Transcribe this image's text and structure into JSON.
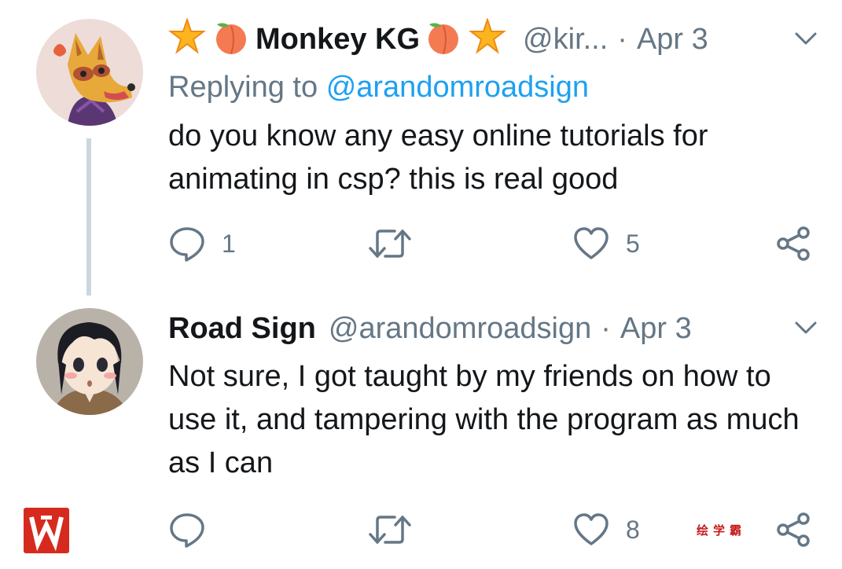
{
  "tweets": [
    {
      "name_prefix_emoji": "🌟🍑",
      "name": "Monkey KG",
      "name_suffix_emoji": "🍑🌟",
      "handle": "@kir...",
      "separator": "·",
      "date": "Apr 3",
      "replying_label": "Replying to",
      "replying_handle": "@arandomroadsign",
      "body": "do you know any easy online tutorials for animating in csp? this is real good",
      "reply_count": "1",
      "retweet_count": "",
      "like_count": "5"
    },
    {
      "name": "Road Sign",
      "handle": "@arandomroadsign",
      "separator": "·",
      "date": "Apr 3",
      "body": "Not sure, I got taught by my friends on how to use it, and tampering with the program as much as I can",
      "reply_count": "",
      "retweet_count": "",
      "like_count": "8"
    }
  ],
  "watermark": {
    "right_text": "绘学霸"
  },
  "colors": {
    "text_primary": "#14171a",
    "text_secondary": "#657786",
    "link": "#1da1f2",
    "thread_line": "#ccd6dd",
    "watermark_red": "#d72a1e"
  },
  "icons": [
    "reply-icon",
    "retweet-icon",
    "like-icon",
    "share-icon",
    "chevron-down-icon"
  ]
}
